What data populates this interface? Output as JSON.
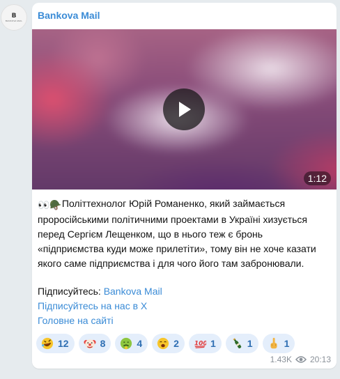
{
  "channel": {
    "name": "Bankova Mail",
    "avatar_text": "B",
    "avatar_subtext": "BANKOVA MAIL"
  },
  "video": {
    "duration": "1:12"
  },
  "post": {
    "lead_emoji": "👀🪖",
    "text": "Політтехнолог Юрій Романенко, який займається проросійськими політичними проектами в Україні хизується перед Сергієм Лещенком, що в нього теж є бронь «підприємства куди може прилетіти», тому він не хоче казати якого саме підприємства і для чого його там забронювали."
  },
  "subscribe": {
    "prefix": "Підписуйтесь: ",
    "channel_link": "Bankova Mail",
    "x_link": "Підписуйтесь на нас в Х",
    "site_link": "Головне на сайті"
  },
  "reactions": [
    {
      "icon": "rofl-emoji",
      "count": "12"
    },
    {
      "icon": "clown-emoji",
      "count": "8"
    },
    {
      "icon": "nauseated-emoji",
      "count": "4"
    },
    {
      "icon": "yawning-emoji",
      "count": "2"
    },
    {
      "icon": "hundred-points-emoji",
      "count": "1"
    },
    {
      "icon": "champagne-emoji",
      "count": "1"
    },
    {
      "icon": "middle-finger-emoji",
      "count": "1"
    }
  ],
  "meta": {
    "views": "1.43K",
    "time": "20:13"
  },
  "colors": {
    "link": "#3a8bd6",
    "reaction_bg": "#e4eefb",
    "reaction_count": "#2f6fb3",
    "chat_bg": "#e6ebee"
  }
}
